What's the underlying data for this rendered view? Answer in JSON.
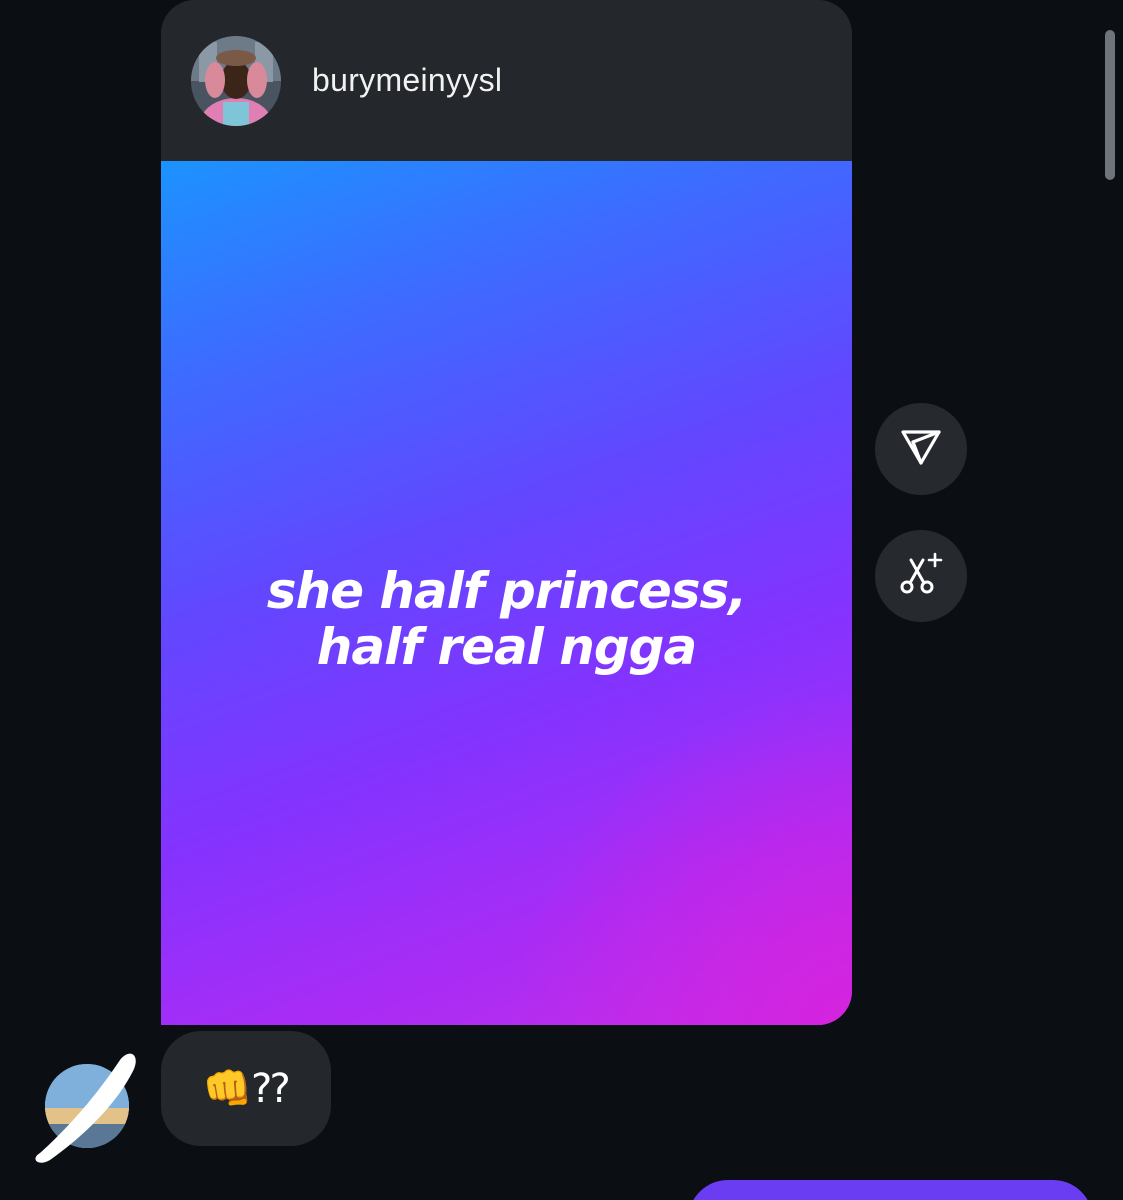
{
  "post": {
    "author_username": "burymeinyysl",
    "caption_line1": "she half princess,",
    "caption_line2": "half real ngga",
    "media_gradient_colors": [
      "#1c93ff",
      "#6247ff",
      "#8433ff",
      "#d622de"
    ]
  },
  "actions": {
    "share_icon": "paper-plane-icon",
    "remix_icon": "scissors-sparkle-icon"
  },
  "reply": {
    "text": "👊⁇"
  },
  "colors": {
    "background": "#0b0f14",
    "card": "#24272b",
    "outgoing_bubble": "#6a3df2"
  }
}
